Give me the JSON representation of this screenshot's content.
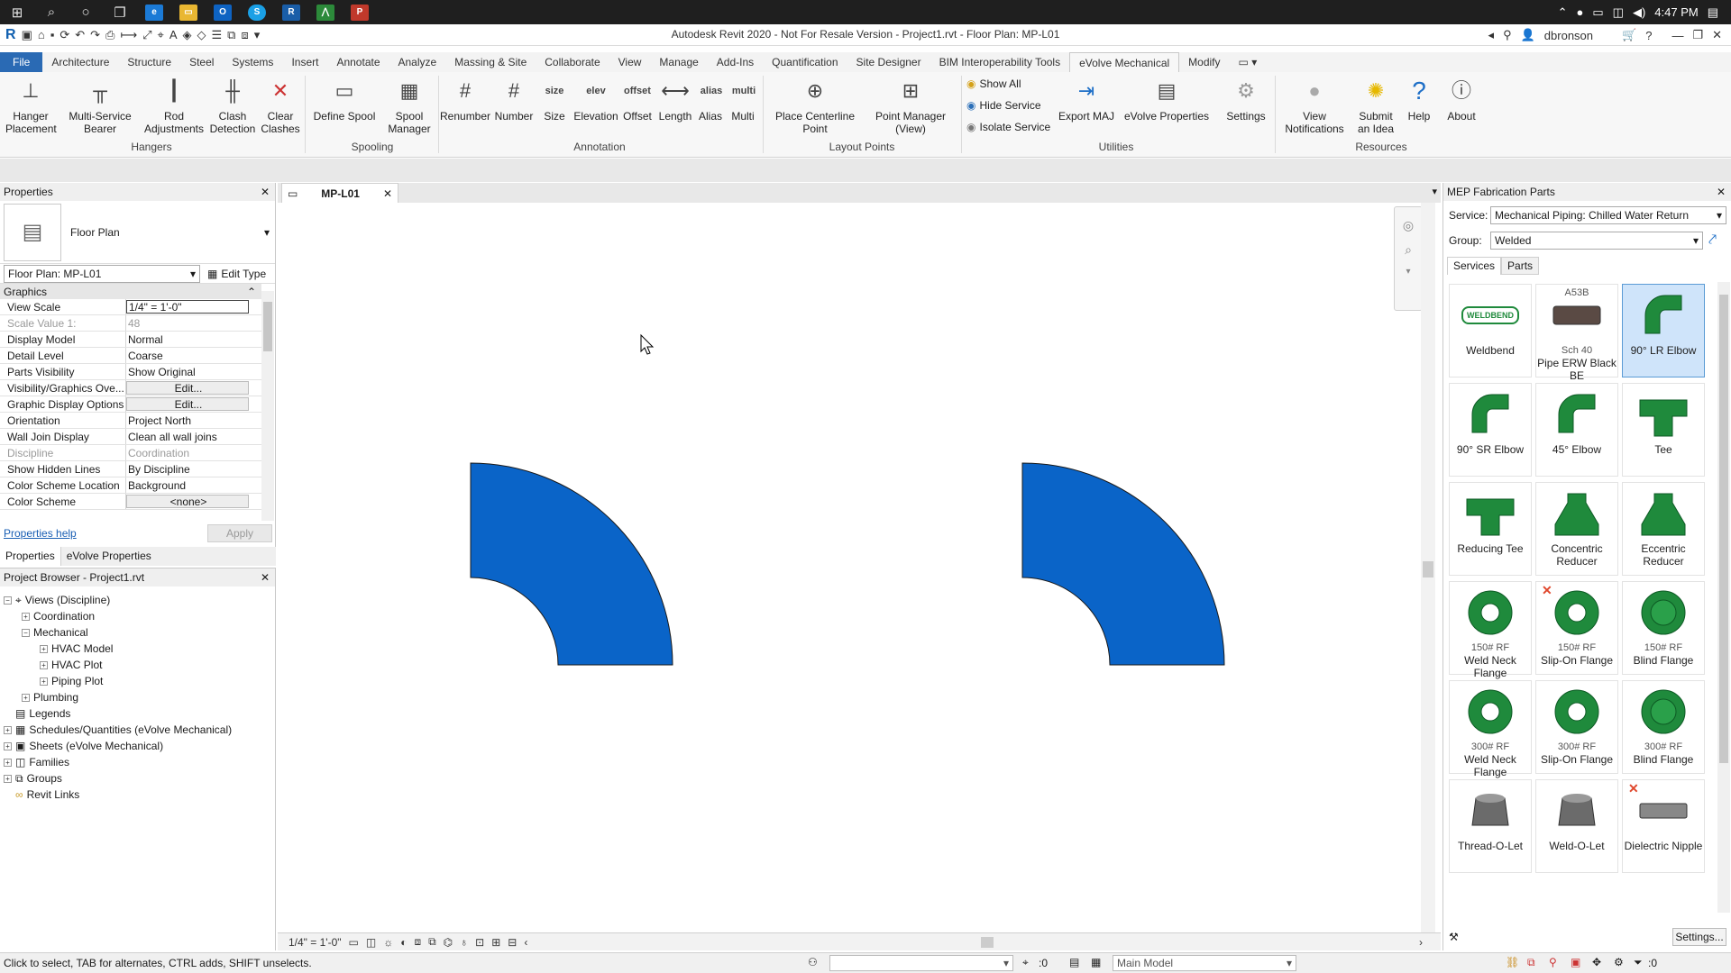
{
  "taskbar": {
    "clock": "4:47 PM"
  },
  "titlebar": {
    "title": "Autodesk Revit 2020 - Not For Resale Version - Project1.rvt - Floor Plan: MP-L01",
    "user": "dbronson"
  },
  "tabs": [
    "File",
    "Architecture",
    "Structure",
    "Steel",
    "Systems",
    "Insert",
    "Annotate",
    "Analyze",
    "Massing & Site",
    "Collaborate",
    "View",
    "Manage",
    "Add-Ins",
    "Quantification",
    "Site Designer",
    "BIM Interoperability Tools",
    "eVolve Mechanical",
    "Modify"
  ],
  "active_tab": "eVolve Mechanical",
  "ribbon": {
    "hangers": {
      "label": "Hangers",
      "buttons": [
        "Hanger Placement",
        "Multi-Service Bearer",
        "Rod Adjustments",
        "Clash Detection",
        "Clear Clashes"
      ]
    },
    "spooling": {
      "label": "Spooling",
      "buttons": [
        "Define Spool",
        "Spool Manager"
      ]
    },
    "annotation": {
      "label": "Annotation",
      "buttons": [
        "Renumber",
        "Number",
        "Size",
        "Elevation",
        "Offset",
        "Length",
        "Alias",
        "Multi"
      ],
      "icon_text": [
        "#",
        "#",
        "size",
        "elev",
        "offset",
        "⟷",
        "alias",
        "multi"
      ]
    },
    "layout_points": {
      "label": "Layout Points",
      "buttons": [
        "Place Centerline Point",
        "Point Manager (View)"
      ]
    },
    "utilities": {
      "label": "Utilities",
      "small": [
        "Show All",
        "Hide Service",
        "Isolate Service"
      ],
      "buttons": [
        "Export MAJ",
        "eVolve Properties"
      ]
    },
    "settings": "Settings",
    "resources": {
      "label": "Resources",
      "buttons": [
        "View Notifications",
        "Submit an Idea",
        "Help",
        "About"
      ]
    }
  },
  "properties": {
    "title": "Properties",
    "type_name": "Floor Plan",
    "instance": "Floor Plan: MP-L01",
    "edit_type": "Edit Type",
    "group": "Graphics",
    "rows": [
      {
        "k": "View Scale",
        "v": "1/4\" = 1'-0\""
      },
      {
        "k": "Scale Value    1:",
        "v": "48"
      },
      {
        "k": "Display Model",
        "v": "Normal"
      },
      {
        "k": "Detail Level",
        "v": "Coarse"
      },
      {
        "k": "Parts Visibility",
        "v": "Show Original"
      },
      {
        "k": "Visibility/Graphics Ove...",
        "v": "Edit..."
      },
      {
        "k": "Graphic Display Options",
        "v": "Edit..."
      },
      {
        "k": "Orientation",
        "v": "Project North"
      },
      {
        "k": "Wall Join Display",
        "v": "Clean all wall joins"
      },
      {
        "k": "Discipline",
        "v": "Coordination"
      },
      {
        "k": "Show Hidden Lines",
        "v": "By Discipline"
      },
      {
        "k": "Color Scheme Location",
        "v": "Background"
      },
      {
        "k": "Color Scheme",
        "v": "<none>"
      }
    ],
    "help_link": "Properties help",
    "apply": "Apply",
    "tabs": [
      "Properties",
      "eVolve Properties"
    ]
  },
  "browser": {
    "title": "Project Browser - Project1.rvt",
    "items": [
      "Views (Discipline)",
      "Coordination",
      "Mechanical",
      "HVAC Model",
      "HVAC Plot",
      "Piping Plot",
      "Plumbing",
      "Legends",
      "Schedules/Quantities (eVolve Mechanical)",
      "Sheets (eVolve Mechanical)",
      "Families",
      "Groups",
      "Revit Links"
    ]
  },
  "view": {
    "tab": "MP-L01",
    "scale": "1/4\" = 1'-0\"",
    "fill_color": "#0a64c8"
  },
  "mep": {
    "title": "MEP Fabrication Parts",
    "service_label": "Service:",
    "service": "Mechanical Piping: Chilled Water Return",
    "group_label": "Group:",
    "group": "Welded",
    "tabs": [
      "Services",
      "Parts"
    ],
    "parts": [
      {
        "name": "Weldbend",
        "logo": "WELDBEND"
      },
      {
        "name": "Pipe ERW Black BE",
        "top": "A53B",
        "sub": "Sch 40"
      },
      {
        "name": "90° LR Elbow",
        "selected": true
      },
      {
        "name": "90° SR Elbow"
      },
      {
        "name": "45° Elbow"
      },
      {
        "name": "Tee"
      },
      {
        "name": "Reducing Tee"
      },
      {
        "name": "Concentric Reducer"
      },
      {
        "name": "Eccentric Reducer"
      },
      {
        "name": "Weld Neck Flange",
        "sub": "150# RF"
      },
      {
        "name": "Slip-On Flange",
        "sub": "150# RF",
        "x": true
      },
      {
        "name": "Blind Flange",
        "sub": "150# RF"
      },
      {
        "name": "Weld Neck Flange",
        "sub": "300# RF"
      },
      {
        "name": "Slip-On Flange",
        "sub": "300# RF"
      },
      {
        "name": "Blind Flange",
        "sub": "300# RF"
      },
      {
        "name": "Thread-O-Let"
      },
      {
        "name": "Weld-O-Let"
      },
      {
        "name": "Dielectric Nipple",
        "x": true
      }
    ],
    "settings": "Settings..."
  },
  "status": {
    "hint": "Click to select, TAB for alternates, CTRL adds, SHIFT unselects.",
    "count": ":0",
    "model": "Main Model",
    "filter": ":0"
  }
}
